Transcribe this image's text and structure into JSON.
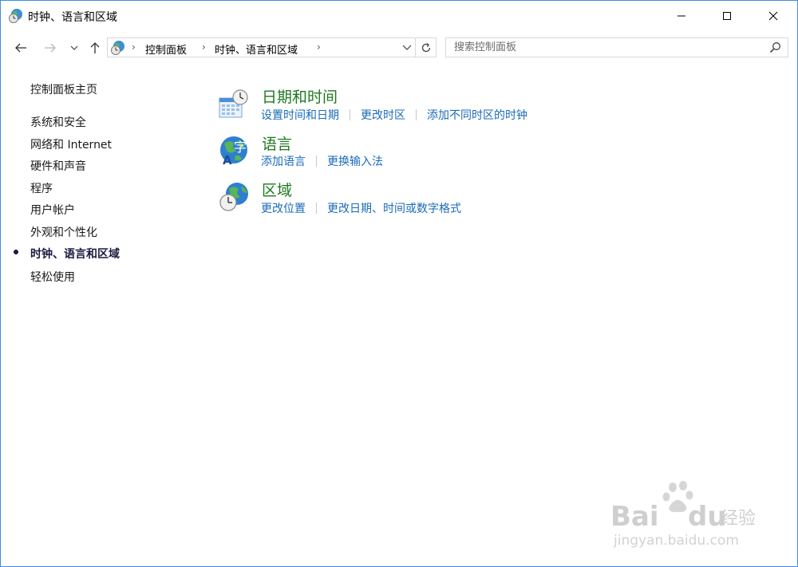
{
  "window": {
    "title": "时钟、语言和区域"
  },
  "nav": {
    "breadcrumbs": [
      "控制面板",
      "时钟、语言和区域"
    ],
    "search_placeholder": "搜索控制面板"
  },
  "sidebar": {
    "home": "控制面板主页",
    "items": [
      {
        "label": "系统和安全"
      },
      {
        "label": "网络和 Internet"
      },
      {
        "label": "硬件和声音"
      },
      {
        "label": "程序"
      },
      {
        "label": "用户帐户"
      },
      {
        "label": "外观和个性化"
      },
      {
        "label": "时钟、语言和区域",
        "current": true
      },
      {
        "label": "轻松使用"
      }
    ]
  },
  "categories": [
    {
      "title": "日期和时间",
      "icon": "calendar-clock-icon",
      "tasks": [
        "设置时间和日期",
        "更改时区",
        "添加不同时区的时钟"
      ]
    },
    {
      "title": "语言",
      "icon": "language-globe-icon",
      "tasks": [
        "添加语言",
        "更换输入法"
      ]
    },
    {
      "title": "区域",
      "icon": "region-globe-clock-icon",
      "tasks": [
        "更改位置",
        "更改日期、时间或数字格式"
      ]
    }
  ],
  "watermark": {
    "brand": "Bai",
    "brand2": "du",
    "brand_cn": "经验",
    "url": "jingyan.baidu.com"
  },
  "colors": {
    "category_title": "#1e7a1e",
    "task_link": "#1a6bb8",
    "window_border": "#3a8ee6"
  }
}
